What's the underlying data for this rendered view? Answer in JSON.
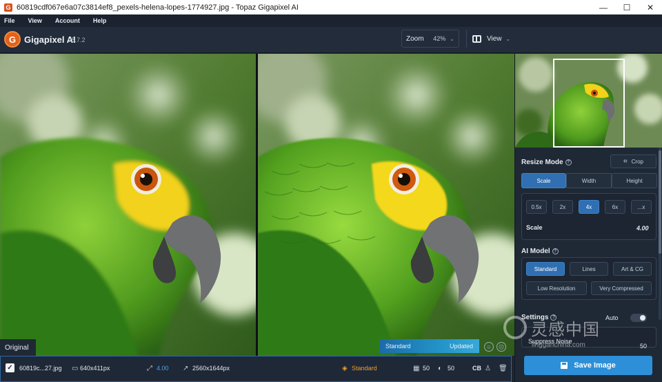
{
  "window": {
    "title": "60819cdf067e6a07c3814ef8_pexels-helena-lopes-1774927.jpg - Topaz Gigapixel AI",
    "controls": {
      "minimize": "—",
      "maximize": "☐",
      "close": "✕"
    }
  },
  "menu": [
    "File",
    "View",
    "Account",
    "Help"
  ],
  "header": {
    "app_name": "Gigapixel AI",
    "version": "v5.7.2",
    "logo_letter": "G",
    "zoom_label": "Zoom",
    "zoom_value": "42%",
    "view_label": "View"
  },
  "preview": {
    "original_label": "Original",
    "model_label": "Standard",
    "status_label": "Updated"
  },
  "panel": {
    "resize_mode_title": "Resize Mode",
    "crop_label": "Crop",
    "resize_tabs": [
      "Scale",
      "Width",
      "Height"
    ],
    "active_resize_tab": "Scale",
    "scale_presets": [
      "0.5x",
      "2x",
      "4x",
      "6x",
      "...x"
    ],
    "active_scale": "4x",
    "scale_label": "Scale",
    "scale_value": "4.00",
    "ai_model_title": "AI Model",
    "models_row1": [
      "Standard",
      "Lines",
      "Art & CG"
    ],
    "models_row2": [
      "Low Resolution",
      "Very Compressed"
    ],
    "active_model": "Standard",
    "settings_title": "Settings",
    "settings_auto": "Auto",
    "suppress_noise_label": "Suppress Noise",
    "suppress_noise_value": "50",
    "save_label": "Save Image"
  },
  "watermark": {
    "cn": "灵感中国",
    "en": "lingganchina.com"
  },
  "status": {
    "filename": "60819c...27.jpg",
    "input_size": "640x411px",
    "scale": "4.00",
    "output_size": "2560x1644px",
    "model": "Standard",
    "noise": "50",
    "blur": "50",
    "cb": "CB"
  },
  "colors": {
    "accent": "#2d8fd8",
    "active_button": "#2f6fb2",
    "model_highlight": "#f0a030"
  }
}
